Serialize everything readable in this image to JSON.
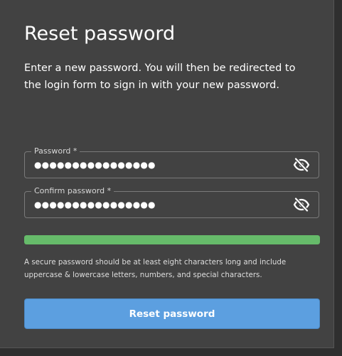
{
  "page": {
    "title": "Reset password",
    "subtitle": "Enter a new password. You will then be redirected to the login form to sign in with your new password."
  },
  "fields": [
    {
      "label": "Password *",
      "value": "●●●●●●●●●●●●●●●●",
      "icon": "eye-off-icon"
    },
    {
      "label": "Confirm password *",
      "value": "●●●●●●●●●●●●●●●●",
      "icon": "eye-off-icon"
    }
  ],
  "strength": {
    "level": 1.0,
    "color": "#66bb6a"
  },
  "hint": "A secure password should be at least eight characters long and include uppercase & lowercase letters, numbers, and special characters.",
  "submit": {
    "label": "Reset password",
    "color": "#5c9fe0"
  }
}
